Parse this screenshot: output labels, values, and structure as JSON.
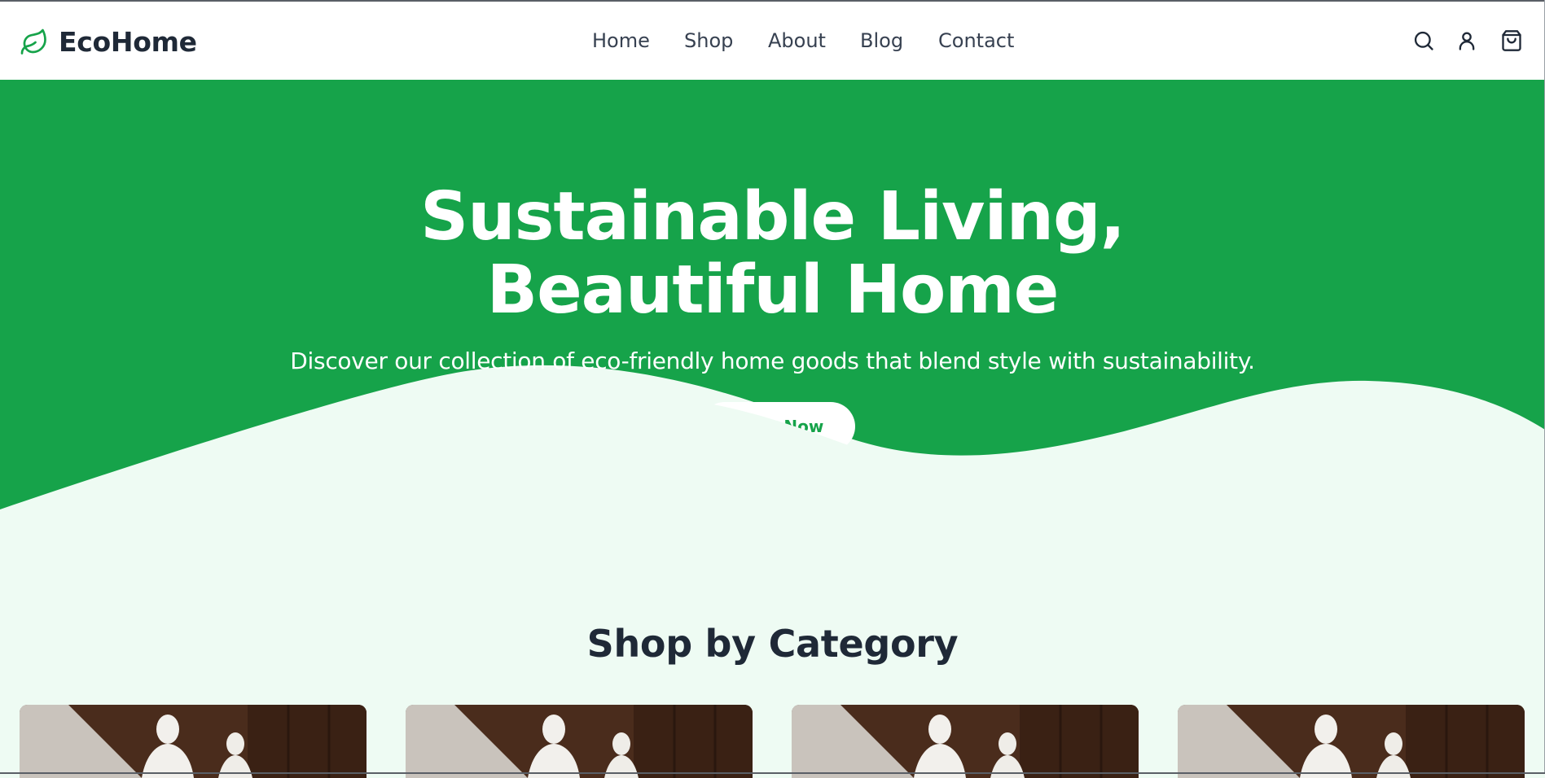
{
  "header": {
    "brand": "EcoHome",
    "nav": [
      "Home",
      "Shop",
      "About",
      "Blog",
      "Contact"
    ],
    "icons": [
      "search-icon",
      "user-icon",
      "shopping-bag-icon"
    ]
  },
  "hero": {
    "title_line1": "Sustainable Living,",
    "title_line2": "Beautiful Home",
    "subtitle": "Discover our collection of eco-friendly home goods that blend style with sustainability.",
    "cta_label": "Shop Now",
    "background_color": "#16a34a",
    "wave_color": "#eefbf3"
  },
  "categories": {
    "title": "Shop by Category",
    "cards": [
      {
        "image": "category-photo"
      },
      {
        "image": "category-photo"
      },
      {
        "image": "category-photo"
      },
      {
        "image": "category-photo"
      }
    ]
  },
  "colors": {
    "brand_green": "#16a34a",
    "text_dark": "#1f2937",
    "page_bg": "#eefbf3"
  }
}
